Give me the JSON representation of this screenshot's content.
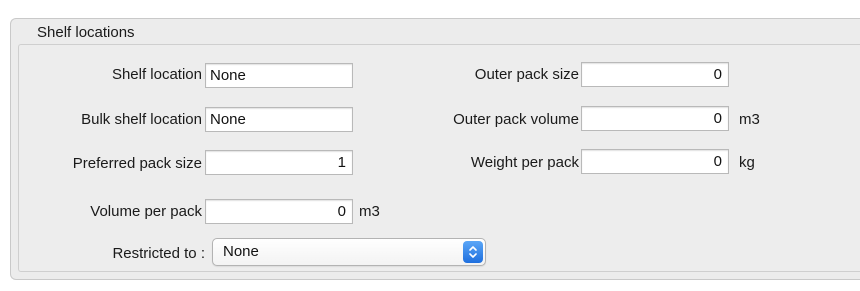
{
  "section": {
    "title": "Shelf locations"
  },
  "left": {
    "shelf_location": {
      "label": "Shelf location",
      "value": "None"
    },
    "bulk_shelf_location": {
      "label": "Bulk shelf location",
      "value": "None"
    },
    "preferred_pack_size": {
      "label": "Preferred pack size",
      "value": "1"
    },
    "volume_per_pack": {
      "label": "Volume per pack",
      "value": "0",
      "unit": "m3"
    }
  },
  "right": {
    "outer_pack_size": {
      "label": "Outer pack size",
      "value": "0"
    },
    "outer_pack_volume": {
      "label": "Outer pack volume",
      "value": "0",
      "unit": "m3"
    },
    "weight_per_pack": {
      "label": "Weight per pack",
      "value": "0",
      "unit": "kg"
    }
  },
  "restricted": {
    "label": "Restricted to :",
    "selected": "None"
  },
  "icons": {
    "select_arrows": "updown-chevron-icon"
  },
  "colors": {
    "panel_background": "#ececec",
    "select_accent": "#2f7fe8"
  }
}
